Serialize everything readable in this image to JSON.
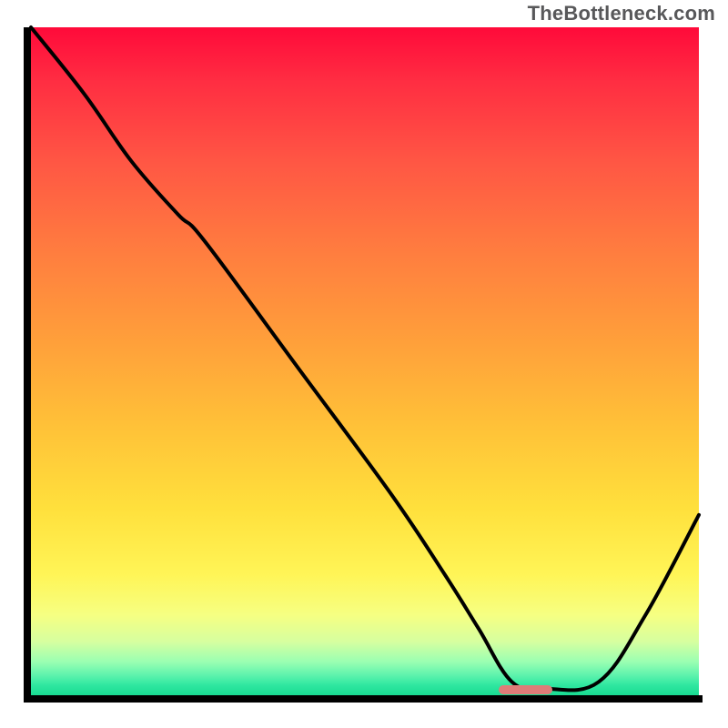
{
  "watermark": "TheBottleneck.com",
  "chart_data": {
    "type": "line",
    "title": "",
    "xlabel": "",
    "ylabel": "",
    "xlim": [
      0,
      100
    ],
    "ylim": [
      0,
      100
    ],
    "grid": false,
    "legend": false,
    "background_gradient": {
      "stops": [
        {
          "pos": 0.0,
          "color": "#ff0a3a"
        },
        {
          "pos": 0.2,
          "color": "#ff5644"
        },
        {
          "pos": 0.48,
          "color": "#ffa23a"
        },
        {
          "pos": 0.72,
          "color": "#ffe03c"
        },
        {
          "pos": 0.88,
          "color": "#f6ff82"
        },
        {
          "pos": 0.95,
          "color": "#9affb2"
        },
        {
          "pos": 1.0,
          "color": "#18db92"
        }
      ]
    },
    "series": [
      {
        "name": "bottleneck-curve",
        "x": [
          0,
          8,
          15,
          22,
          26,
          40,
          54,
          62,
          67,
          72,
          77,
          85,
          92,
          100
        ],
        "values": [
          100,
          90,
          80,
          72,
          68,
          49,
          30,
          18,
          10,
          2,
          1,
          2,
          12,
          27
        ]
      }
    ],
    "marker": {
      "name": "optimal-range",
      "x_start": 70,
      "x_end": 78,
      "y": 0.8,
      "color": "#de7c78"
    }
  }
}
